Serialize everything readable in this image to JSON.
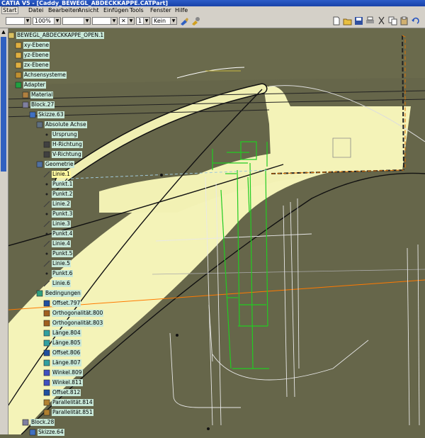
{
  "window": {
    "title": "CATIA V5 - [Caddy_BEWEGL_ABDECKKAPPE.CATPart]"
  },
  "menu": [
    "Start",
    "Datei",
    "Bearbeiten",
    "Ansicht",
    "Einfügen",
    "Tools",
    "Fenster",
    "Hilfe"
  ],
  "toolbar": {
    "zoom": "100%",
    "linetype": "1",
    "layer": "Kein"
  },
  "colors": {
    "accent": "#1d4fb8",
    "model_surface": "#f6f5bc",
    "background": "#66664a",
    "constraints": "#22cc22",
    "axis_orange": "#ff7a00"
  },
  "tree": [
    {
      "label": "BEWEGL_ABDECKKAPPE_OPEN.1",
      "icon": "part-icon"
    },
    {
      "label": "xy-Ebene",
      "icon": "plane-icon"
    },
    {
      "label": "yz-Ebene",
      "icon": "plane-icon"
    },
    {
      "label": "zx-Ebene",
      "icon": "plane-icon"
    },
    {
      "label": "Achsensysteme",
      "icon": "axis-system-icon"
    },
    {
      "label": "Adapter",
      "icon": "body-icon"
    },
    {
      "label": "Material",
      "icon": "material-icon"
    },
    {
      "label": "Block.27",
      "icon": "pad-icon"
    },
    {
      "label": "Skizze.63",
      "icon": "sketch-icon"
    },
    {
      "label": "Absolute Achse",
      "icon": "absolute-axis-icon"
    },
    {
      "label": "Ursprung",
      "icon": "point-icon"
    },
    {
      "label": "H-Richtung",
      "icon": "direction-icon"
    },
    {
      "label": "V-Richtung",
      "icon": "direction-icon"
    },
    {
      "label": "Geometrie",
      "icon": "geometry-icon"
    },
    {
      "label": "Linie.1",
      "icon": "line-icon",
      "selected": true
    },
    {
      "label": "Punkt.1",
      "icon": "point-icon"
    },
    {
      "label": "Punkt.2",
      "icon": "point-icon"
    },
    {
      "label": "Linie.2",
      "icon": "line-icon"
    },
    {
      "label": "Punkt.3",
      "icon": "point-icon"
    },
    {
      "label": "Linie.3",
      "icon": "line-icon"
    },
    {
      "label": "Punkt.4",
      "icon": "point-icon"
    },
    {
      "label": "Linie.4",
      "icon": "line-icon"
    },
    {
      "label": "Punkt.5",
      "icon": "point-icon"
    },
    {
      "label": "Linie.5",
      "icon": "line-icon"
    },
    {
      "label": "Punkt.6",
      "icon": "point-icon"
    },
    {
      "label": "Linie.6",
      "icon": "line-icon"
    },
    {
      "label": "Bedingungen",
      "icon": "constraints-icon"
    },
    {
      "label": "Offset.797",
      "icon": "offset-constraint-icon"
    },
    {
      "label": "Orthogonalität.800",
      "icon": "orthogonality-icon"
    },
    {
      "label": "Orthogonalität.803",
      "icon": "orthogonality-icon"
    },
    {
      "label": "Länge.804",
      "icon": "length-icon"
    },
    {
      "label": "Länge.805",
      "icon": "length-icon"
    },
    {
      "label": "Offset.806",
      "icon": "offset-constraint-icon"
    },
    {
      "label": "Länge.807",
      "icon": "length-icon"
    },
    {
      "label": "Winkel.809",
      "icon": "angle-icon"
    },
    {
      "label": "Winkel.811",
      "icon": "angle-icon"
    },
    {
      "label": "Offset.812",
      "icon": "offset-constraint-icon"
    },
    {
      "label": "Parallelität.814",
      "icon": "parallelism-icon"
    },
    {
      "label": "Parallelität.851",
      "icon": "parallelism-icon"
    },
    {
      "label": "Block.28",
      "icon": "pad-icon"
    },
    {
      "label": "Skizze.64",
      "icon": "sketch-icon"
    }
  ]
}
